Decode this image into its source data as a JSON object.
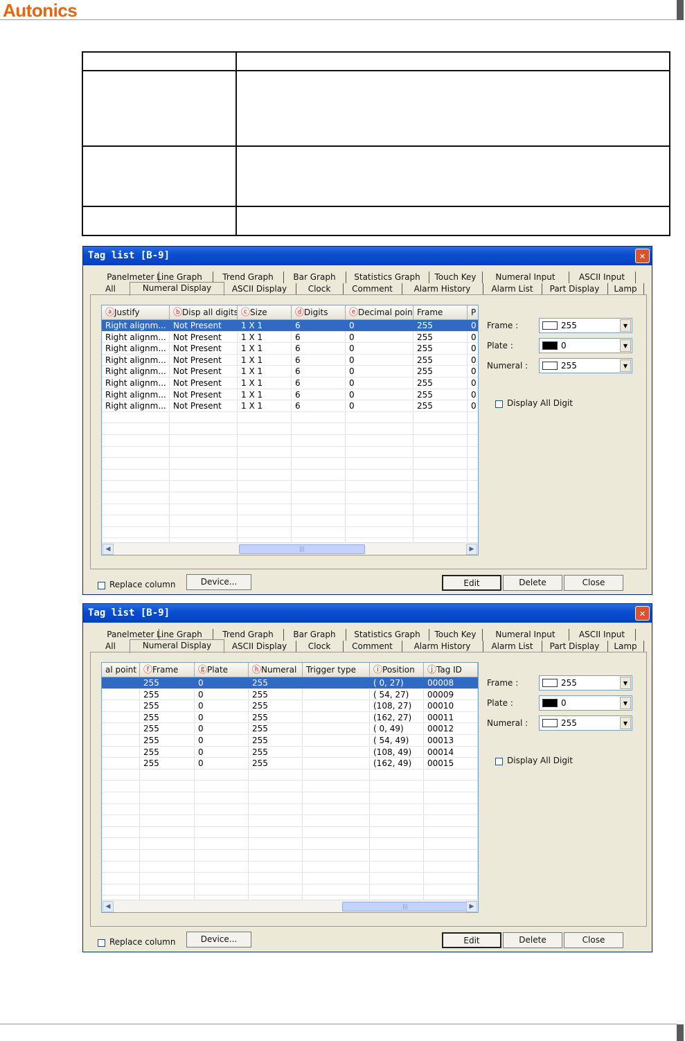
{
  "brand": {
    "logo": "Autonics",
    "color": "#e8650a"
  },
  "colors": {
    "selection": "#316ac5",
    "titlebar": "#0a4fd0",
    "marker": "#e2252b"
  },
  "windows": [
    {
      "title": "Tag list [B-9]",
      "tabs_row1": [
        "Panelmeter",
        "Line Graph",
        "Trend Graph",
        "Bar Graph",
        "Statistics Graph",
        "Touch Key",
        "Numeral Input",
        "ASCII Input"
      ],
      "tabs_row2": [
        "All",
        "Numeral Display",
        "ASCII Display",
        "Clock",
        "Comment",
        "Alarm History",
        "Alarm List",
        "Part Display",
        "Lamp"
      ],
      "active_tab": "Numeral Display",
      "columns": [
        {
          "marker": "ⓐ",
          "label": "Justify"
        },
        {
          "marker": "ⓑ",
          "label": "Disp all digits"
        },
        {
          "marker": "ⓒ",
          "label": "Size"
        },
        {
          "marker": "ⓓ",
          "label": "Digits"
        },
        {
          "marker": "ⓔ",
          "label": "Decimal point"
        },
        {
          "marker": "",
          "label": "Frame"
        },
        {
          "marker": "",
          "label": "P"
        }
      ],
      "rows": [
        [
          "Right alignm...",
          "Not Present",
          "1 X 1",
          "6",
          "0",
          "255",
          "0"
        ],
        [
          "Right alignm...",
          "Not Present",
          "1 X 1",
          "6",
          "0",
          "255",
          "0"
        ],
        [
          "Right alignm...",
          "Not Present",
          "1 X 1",
          "6",
          "0",
          "255",
          "0"
        ],
        [
          "Right alignm...",
          "Not Present",
          "1 X 1",
          "6",
          "0",
          "255",
          "0"
        ],
        [
          "Right alignm...",
          "Not Present",
          "1 X 1",
          "6",
          "0",
          "255",
          "0"
        ],
        [
          "Right alignm...",
          "Not Present",
          "1 X 1",
          "6",
          "0",
          "255",
          "0"
        ],
        [
          "Right alignm...",
          "Not Present",
          "1 X 1",
          "6",
          "0",
          "255",
          "0"
        ],
        [
          "Right alignm...",
          "Not Present",
          "1 X 1",
          "6",
          "0",
          "255",
          "0"
        ]
      ],
      "scroll_position": 0.55,
      "side": {
        "frame_label": "Frame :",
        "frame_value": "255",
        "plate_label": "Plate :",
        "plate_value": "0",
        "numeral_label": "Numeral :",
        "numeral_value": "255",
        "display_all_digit": "Display All Digit"
      },
      "replace_column": "Replace column",
      "buttons": {
        "device": "Device...",
        "edit": "Edit",
        "delete": "Delete",
        "close": "Close"
      }
    },
    {
      "title": "Tag list [B-9]",
      "tabs_row1": [
        "Panelmeter",
        "Line Graph",
        "Trend Graph",
        "Bar Graph",
        "Statistics Graph",
        "Touch Key",
        "Numeral Input",
        "ASCII Input"
      ],
      "tabs_row2": [
        "All",
        "Numeral Display",
        "ASCII Display",
        "Clock",
        "Comment",
        "Alarm History",
        "Alarm List",
        "Part Display",
        "Lamp"
      ],
      "active_tab": "Numeral Display",
      "columns": [
        {
          "marker": "",
          "label": "al point"
        },
        {
          "marker": "ⓕ",
          "label": "Frame"
        },
        {
          "marker": "ⓖ",
          "label": "Plate"
        },
        {
          "marker": "ⓗ",
          "label": "Numeral"
        },
        {
          "marker": "",
          "label": "Trigger type"
        },
        {
          "marker": "ⓘ",
          "label": "Position"
        },
        {
          "marker": "ⓙ",
          "label": "Tag ID"
        }
      ],
      "rows": [
        [
          "",
          "255",
          "0",
          "255",
          "",
          " ( 0,  27)",
          "00008"
        ],
        [
          "",
          "255",
          "0",
          "255",
          "",
          " ( 54,  27)",
          "00009"
        ],
        [
          "",
          "255",
          "0",
          "255",
          "",
          "(108,  27)",
          "00010"
        ],
        [
          "",
          "255",
          "0",
          "255",
          "",
          "(162,  27)",
          "00011"
        ],
        [
          "",
          "255",
          "0",
          "255",
          "",
          " ( 0,  49)",
          "00012"
        ],
        [
          "",
          "255",
          "0",
          "255",
          "",
          " ( 54,  49)",
          "00013"
        ],
        [
          "",
          "255",
          "0",
          "255",
          "",
          "(108,  49)",
          "00014"
        ],
        [
          "",
          "255",
          "0",
          "255",
          "",
          "(162,  49)",
          "00015"
        ]
      ],
      "scroll_position": 1.0,
      "side": {
        "frame_label": "Frame :",
        "frame_value": "255",
        "plate_label": "Plate :",
        "plate_value": "0",
        "numeral_label": "Numeral :",
        "numeral_value": "255",
        "display_all_digit": "Display All Digit"
      },
      "replace_column": "Replace column",
      "buttons": {
        "device": "Device...",
        "edit": "Edit",
        "delete": "Delete",
        "close": "Close"
      }
    }
  ]
}
